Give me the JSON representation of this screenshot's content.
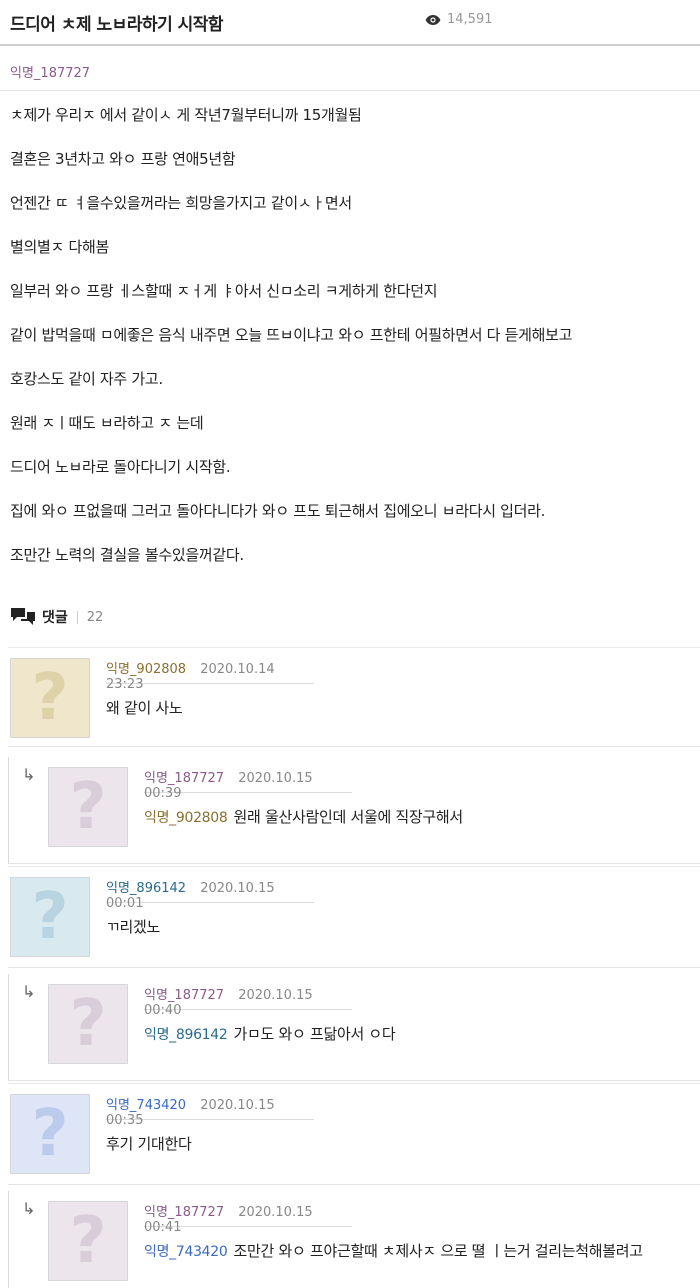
{
  "post": {
    "title": "드디어 ㅊ제 노ㅂ라하기 시작함",
    "views": "14,591",
    "author": "익명_187727",
    "lines": [
      "ㅊ제가 우리ㅈ 에서 같이ㅅ 게 작년7월부터니까 15개월됨",
      "결혼은 3년차고 와ㅇ 프랑 연애5년함",
      "언젠간 ㄸ  ㅕ을수있을꺼라는 희망을가지고 같이ㅅㅏ면서",
      "별의별ㅈ 다해봄",
      "일부러 와ㅇ 프랑  ㅔ스할때 ㅈㅓ게  ㅑ아서 신ㅁ소리 ㅋ게하게 한다던지",
      "같이 밥먹을때 ㅁ에좋은 음식 내주면 오늘 뜨ㅂ이냐고 와ㅇ 프한테 어필하면서 다 듣게해보고",
      "호캉스도 같이 자주 가고.",
      "원래 ㅈㅣ때도 ㅂ라하고 ㅈ 는데",
      "드디어 노ㅂ라로 돌아다니기 시작함.",
      "집에 와ㅇ 프없을때 그러고 돌아다니다가 와ㅇ 프도 퇴근해서 집에오니 ㅂ라다시 입더라.",
      "조만간 노력의 결실을 볼수있을꺼같다."
    ]
  },
  "comments_header": {
    "label": "댓글",
    "count": "22"
  },
  "comments": [
    {
      "name": "익명_902808",
      "date": "2020.10.14 23:23",
      "to": "",
      "text": "왜 같이 사노",
      "avatar_color": "#efe6cc",
      "q_color": "#ddd2a8",
      "name_color": "#8a7030"
    },
    {
      "name": "익명_187727",
      "date": "2020.10.15 00:39",
      "to": "익명_902808",
      "text": "원래 울산사람인데 서울에 직장구해서",
      "avatar_color": "#ece6ec",
      "q_color": "#d9cdd9",
      "name_color": "#8a5a8a",
      "to_color": "#8a7030"
    },
    {
      "name": "익명_896142",
      "date": "2020.10.15 00:01",
      "to": "",
      "text": "ㄲ리겠노",
      "avatar_color": "#d9e9f0",
      "q_color": "#b8d4e0",
      "name_color": "#2a6a8a"
    },
    {
      "name": "익명_187727",
      "date": "2020.10.15 00:40",
      "to": "익명_896142",
      "text": "가ㅁ도 와ㅇ 프닮아서 ㅇ다",
      "avatar_color": "#ece6ec",
      "q_color": "#d9cdd9",
      "name_color": "#8a5a8a",
      "to_color": "#2a6a8a"
    },
    {
      "name": "익명_743420",
      "date": "2020.10.15 00:35",
      "to": "",
      "text": "후기 기대한다",
      "avatar_color": "#dde5f6",
      "q_color": "#bccbec",
      "name_color": "#3a6abf"
    },
    {
      "name": "익명_187727",
      "date": "2020.10.15 00:41",
      "to": "익명_743420",
      "text": "조만간 와ㅇ 프야근할때 ㅊ제사ㅈ 으로 뗠  ㅣ는거 걸리는척해볼려고",
      "avatar_color": "#ece6ec",
      "q_color": "#d9cdd9",
      "name_color": "#8a5a8a",
      "to_color": "#3a6abf"
    }
  ],
  "icons": {
    "views": "eye-icon",
    "comments": "speech-bubbles-icon",
    "reply": "reply-arrow-icon",
    "avatar": "question-mark-avatar-icon"
  }
}
